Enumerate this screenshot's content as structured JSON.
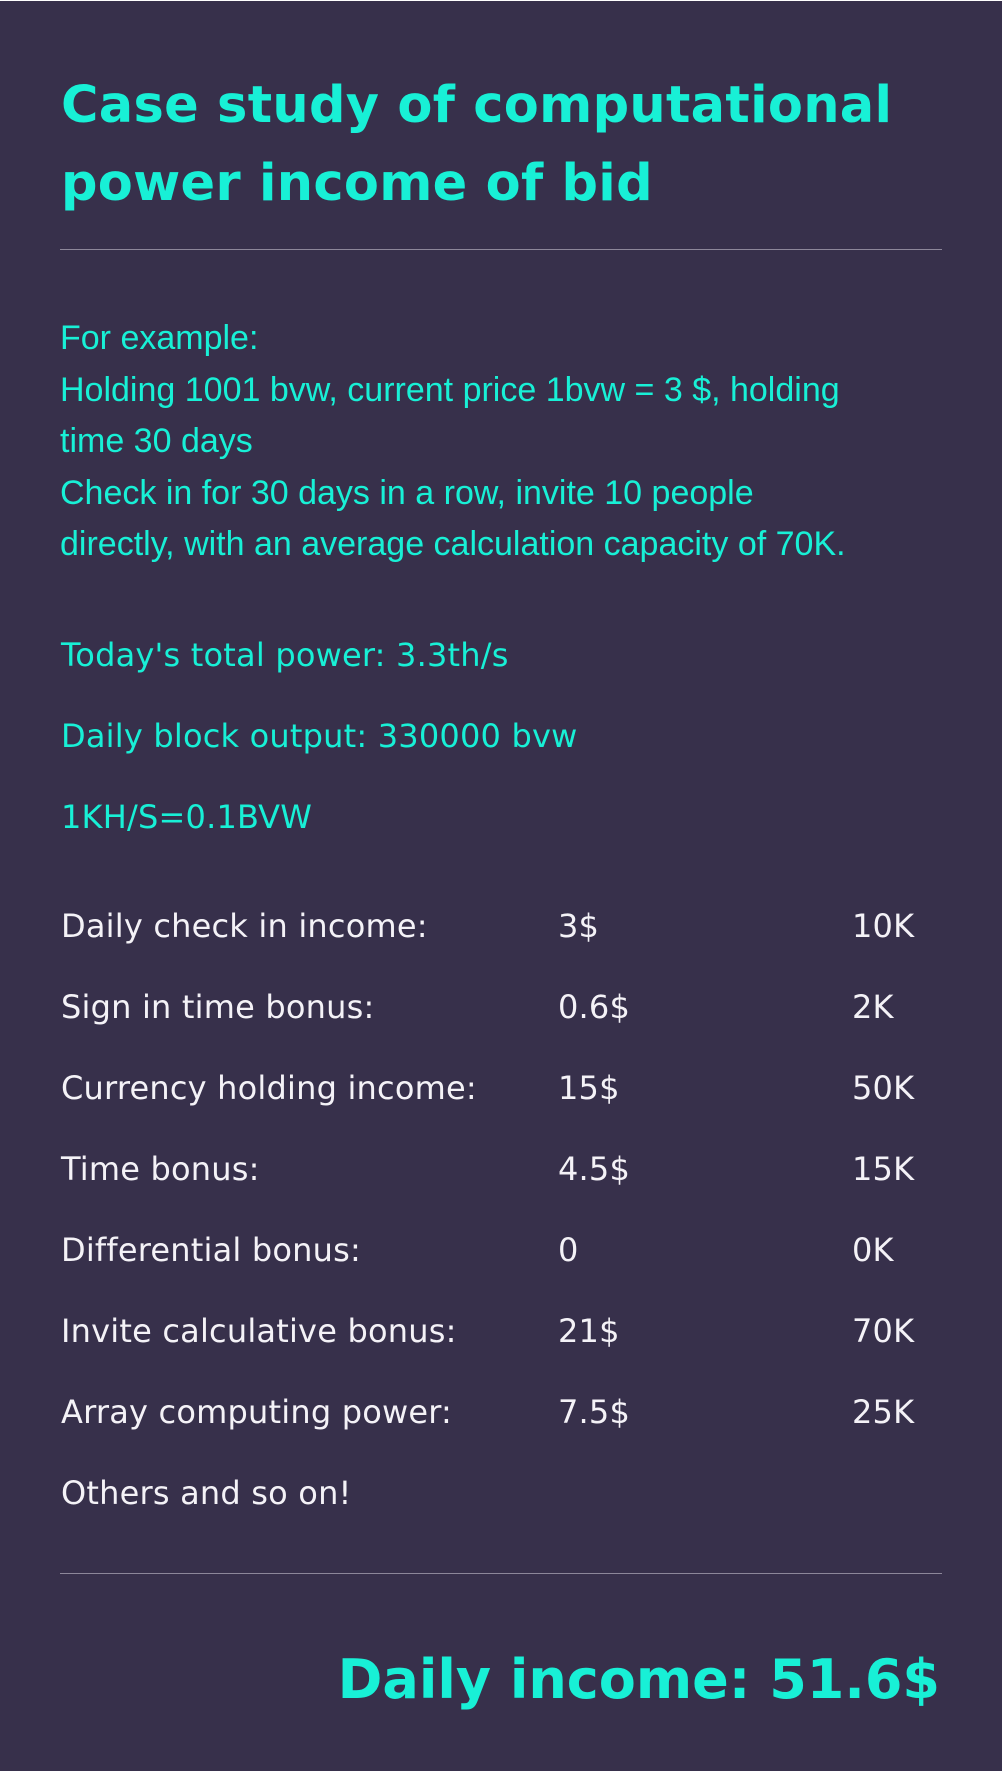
{
  "title": "Case study of computational power income of bid",
  "example": {
    "lines": [
      "For example:",
      "Holding 1001 bvw, current price 1bvw = 3 $, holding",
      "time 30 days",
      "Check in for 30 days in a row, invite 10 people",
      "directly, with an average calculation capacity of 70K."
    ]
  },
  "stats": {
    "total_power": "Today's total power: 3.3th/s",
    "daily_output": "Daily block output: 330000 bvw",
    "conversion": "1KH/S=0.1BVW"
  },
  "income_rows": [
    {
      "label": "Daily check in income:",
      "usd": "3$",
      "power": "10K"
    },
    {
      "label": "Sign in time bonus:",
      "usd": "0.6$",
      "power": "2K"
    },
    {
      "label": "Currency holding income:",
      "usd": "15$",
      "power": "50K"
    },
    {
      "label": "Time bonus:",
      "usd": "4.5$",
      "power": "15K"
    },
    {
      "label": "Differential bonus:",
      "usd": "0",
      "power": "0K"
    },
    {
      "label": "Invite calculative bonus:",
      "usd": "21$",
      "power": "70K"
    },
    {
      "label": "Array computing power:",
      "usd": "7.5$",
      "power": "25K"
    }
  ],
  "others": "Others and so on!",
  "daily_income": "Daily income: 51.6$",
  "colors": {
    "background": "#37304b",
    "accent": "#18f0d6",
    "text": "#f4f2f7",
    "divider": "#8d879a"
  }
}
